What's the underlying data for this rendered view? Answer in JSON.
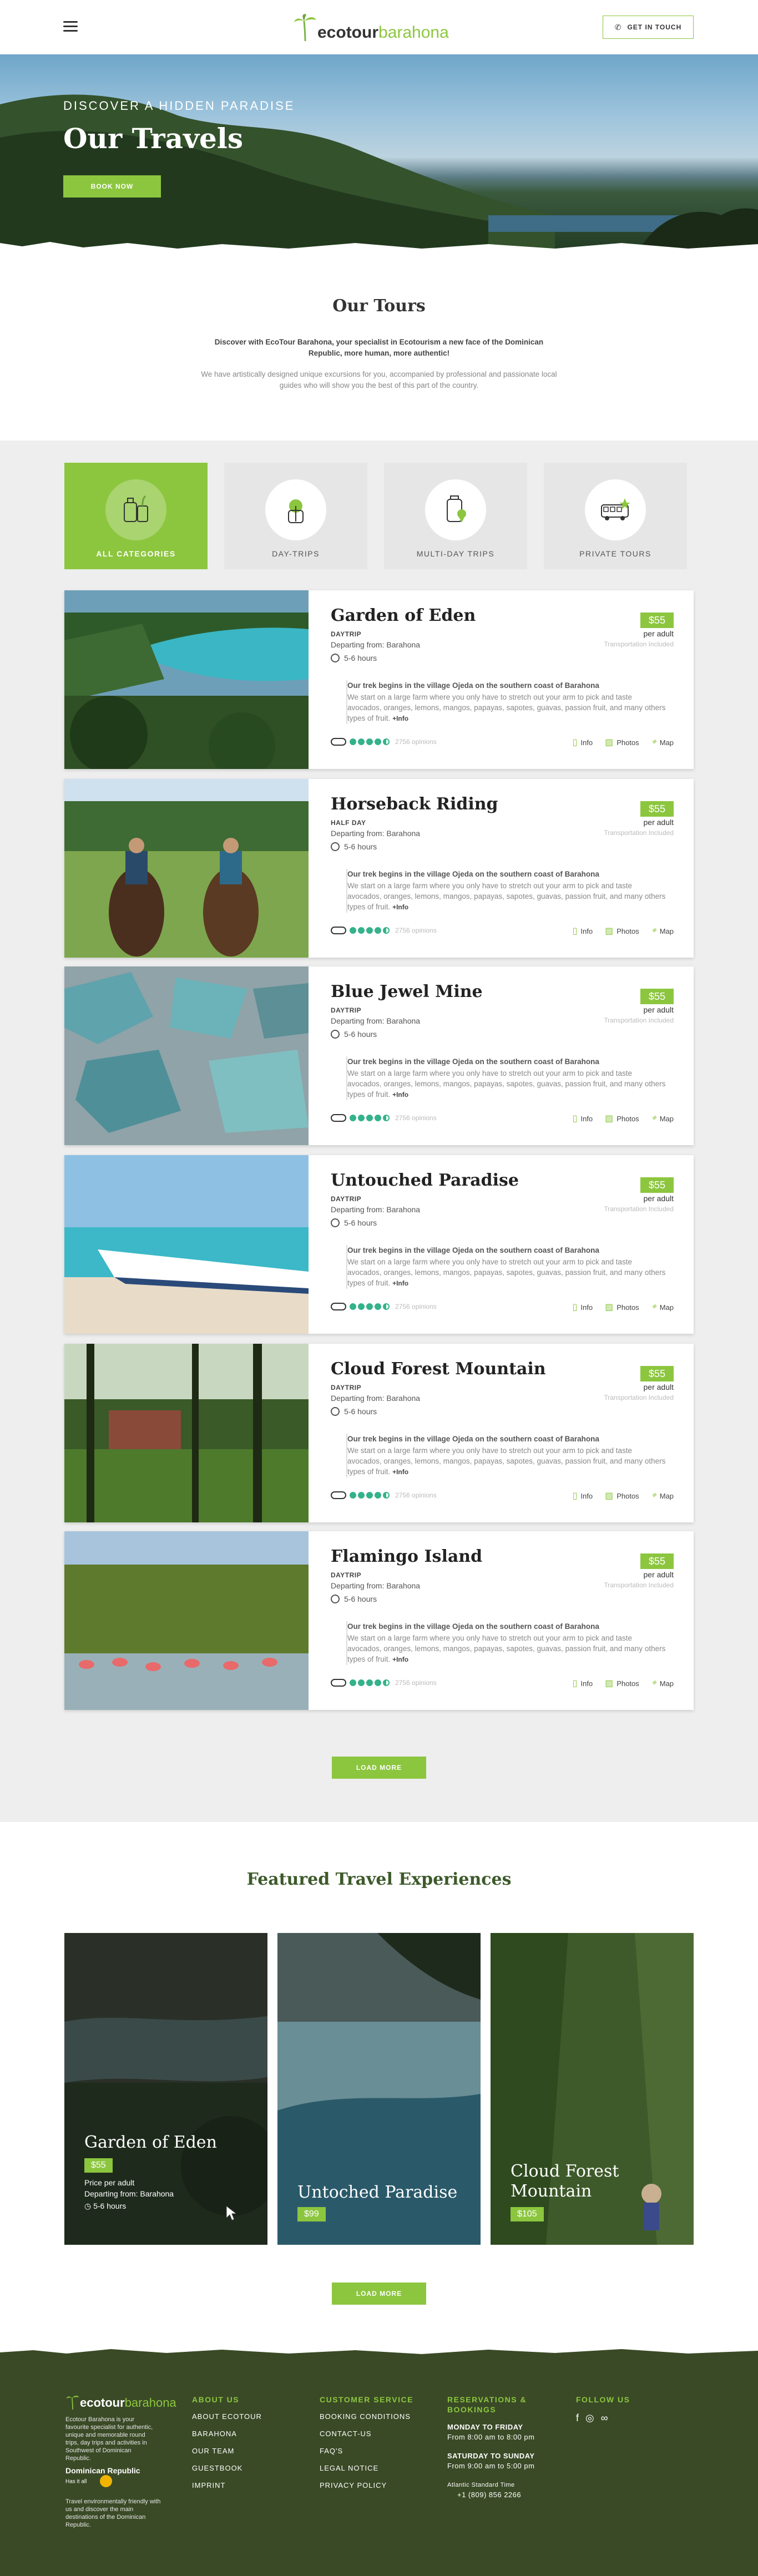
{
  "header": {
    "logo_eco": "ecotour",
    "logo_bar": "barahona",
    "contact_label": "GET IN TOUCH"
  },
  "hero": {
    "kicker": "DISCOVER A HIDDEN PARADISE",
    "title": "Our Travels",
    "book_label": "BOOK NOW"
  },
  "intro": {
    "title": "Our Tours",
    "p1": "Discover with EcoTour Barahona, your specialist in Ecotourism a new face of the Dominican Republic, more human, more authentic!",
    "p2": "We have artistically designed unique excursions for you, accompanied by professional and passionate local guides who will show you the best of this part of the country."
  },
  "categories": [
    {
      "label": "ALL CATEGORIES",
      "icon": "luggage-icon",
      "active": true
    },
    {
      "label": "DAY-TRIPS",
      "icon": "palm-backpack-icon",
      "active": false
    },
    {
      "label": "MULTI-DAY TRIPS",
      "icon": "suitcase-pin-icon",
      "active": false
    },
    {
      "label": "PRIVATE TOURS",
      "icon": "bus-icon",
      "active": false
    }
  ],
  "tour_common": {
    "departing": "Departing from: Barahona",
    "duration": "5-6 hours",
    "price": "$55",
    "per": "per adult",
    "transport": "Transportation Included",
    "desc_title": "Our trek begins in the village Ojeda on the southern coast of Barahona",
    "desc_text": "We start on a large farm where you only have to stretch out your arm to pick and taste avocados, oranges, lemons, mangos, papayas, sapotes, guavas, passion fruit, and many others types of fruit.",
    "more": "+Info",
    "reviews": "2756 opinions",
    "info": "Info",
    "photos": "Photos",
    "map": "Map"
  },
  "tours": [
    {
      "title": "Garden of Eden",
      "kind": "DAYTRIP"
    },
    {
      "title": "Horseback Riding",
      "kind": "HALF DAY"
    },
    {
      "title": "Blue Jewel Mine",
      "kind": "DAYTRIP"
    },
    {
      "title": "Untouched Paradise",
      "kind": "DAYTRIP"
    },
    {
      "title": "Cloud Forest Mountain",
      "kind": "DAYTRIP"
    },
    {
      "title": "Flamingo Island",
      "kind": "DAYTRIP"
    }
  ],
  "load_more": "LOAD MORE",
  "featured": {
    "title": "Featured Travel Experiences",
    "cards": [
      {
        "title": "Garden of Eden",
        "price": "$55",
        "per": "Price per adult",
        "departing": "Departing from: Barahona",
        "duration": "5-6 hours"
      },
      {
        "title": "Untoched Paradise",
        "price": "$99"
      },
      {
        "title": "Cloud Forest Mountain",
        "price": "$105"
      }
    ]
  },
  "footer": {
    "logo_eco": "ecotour",
    "logo_bar": "barahona",
    "about_text": "Ecotour Barahona is your favourite specialist for authentic, unique and memorable round trips, day trips and activities in Southwest of Dominican Republic.",
    "dr_logo": "Dominican Republic",
    "dr_sub": "Has it all",
    "dr_text": "Travel environmentally friendly with us and discover the main destinations of the Dominican Republic.",
    "about_title": "ABOUT US",
    "about_links": [
      "ABOUT ECOTOUR",
      "BARAHONA",
      "OUR TEAM",
      "GUESTBOOK",
      "IMPRINT"
    ],
    "service_title": "CUSTOMER SERVICE",
    "service_links": [
      "BOOKING CONDITIONS",
      "CONTACT-US",
      "FAQ'S",
      "LEGAL NOTICE",
      "PRIVACY POLICY"
    ],
    "res_title": "RESERVATIONS & BOOKINGS",
    "res_days1": "MONDAY TO FRIDAY",
    "res_hours1": "From 8:00 am to 8:00 pm",
    "res_days2": "SATURDAY TO SUNDAY",
    "res_hours2": "From 9:00 am to 5:00 pm",
    "timezone": "Atlantic Standard Time",
    "phone": "+1 (809) 856 2266",
    "follow_title": "FOLLOW US"
  },
  "colors": {
    "accent": "#8cc63f",
    "footer": "#3a4a26",
    "featured_title": "#3d5a2a"
  }
}
